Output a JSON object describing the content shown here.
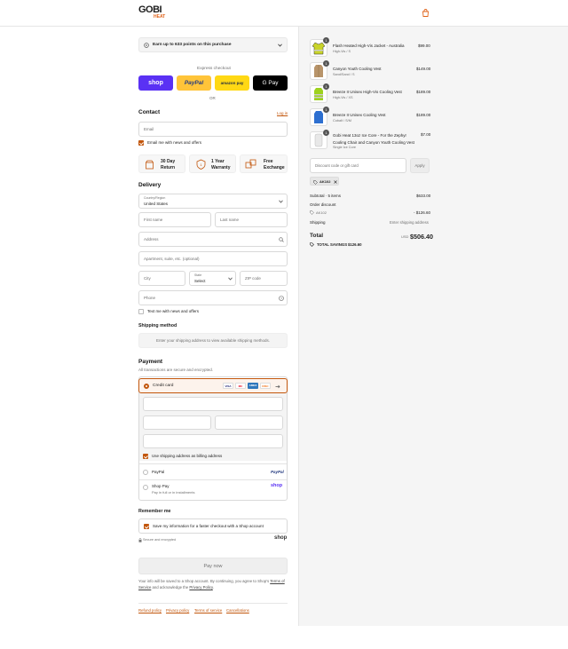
{
  "header": {
    "logo_main": "GOBI",
    "logo_sub": "HEAT"
  },
  "points": {
    "text": "Earn up to 633 points on this purchase"
  },
  "express": {
    "title": "Express checkout",
    "or": "OR",
    "shop": "shop",
    "paypal": "PayPal",
    "amazon": "amazon pay",
    "gpay": "G Pay"
  },
  "contact": {
    "title": "Contact",
    "login": "Log in",
    "email_placeholder": "Email",
    "news_label": "Email me with news and offers"
  },
  "perks": [
    {
      "title": "30 Day",
      "sub": "Return"
    },
    {
      "title": "1 Year",
      "sub": "Warranty"
    },
    {
      "title": "Free",
      "sub": "Exchange"
    }
  ],
  "delivery": {
    "title": "Delivery",
    "country_label": "Country/Region",
    "country_value": "United States",
    "first": "First name",
    "last": "Last name",
    "address": "Address",
    "apt": "Apartment, suite, etc. (optional)",
    "city": "City",
    "state_label": "State",
    "state_value": "Select",
    "zip": "ZIP code",
    "phone": "Phone",
    "text_me": "Text me with news and offers"
  },
  "shipping_method": {
    "title": "Shipping method",
    "placeholder": "Enter your shipping address to view available shipping methods."
  },
  "payment": {
    "title": "Payment",
    "subtitle": "All transactions are secure and encrypted.",
    "credit_card": "Credit card",
    "cards": [
      "VISA",
      "MC",
      "AMEX",
      "DISC"
    ],
    "billing_label": "Use shipping address as billing address",
    "paypal": "PayPal",
    "paypal_logo": "PayPal",
    "shop_pay": "Shop Pay",
    "shop_pay_sub": "Pay in full or in installments",
    "shop_logo": "shop"
  },
  "remember": {
    "title": "Remember me",
    "save_label": "Save my information for a faster checkout with a Shop account",
    "secure": "Secure and encrypted",
    "shop_logo": "shop"
  },
  "pay_now": "Pay now",
  "legal": {
    "pre": "Your info will be saved to a Shop account. By continuing, you agree to Shop's",
    "terms": "Terms of Service",
    "mid": "and acknowledge the",
    "privacy": "Privacy Policy",
    "end": "."
  },
  "footer_links": [
    "Refund policy",
    "Privacy policy",
    "Terms of service",
    "Cancellations"
  ],
  "order": {
    "items": [
      {
        "name": "Flash Heated High-Vis Jacket - Australia",
        "variant": "High-Vis / S",
        "price": "$99.00",
        "qty": "1",
        "color": "#c9d42a"
      },
      {
        "name": "Canyon Youth Cooling Vest",
        "variant": "Sand/Sand / S",
        "price": "$149.00",
        "qty": "1",
        "color": "#b8946a"
      },
      {
        "name": "Breeze II Unisex High-Vis Cooling Vest",
        "variant": "High-Vis / XS",
        "price": "$189.00",
        "qty": "1",
        "color": "#9ed21e"
      },
      {
        "name": "Breeze II Unisex Cooling Vest",
        "variant": "Cobalt / S/M",
        "price": "$189.00",
        "qty": "1",
        "color": "#2d6fd0"
      },
      {
        "name": "Gobi Heat 13oz Ice Core - For the Zephyr Cooling Chair and Canyon Youth Cooling Vest",
        "variant": "Single Ice Core",
        "price": "$7.00",
        "qty": "1",
        "color": "#d9d9d9"
      }
    ],
    "discount_placeholder": "Discount code or gift card",
    "apply": "Apply",
    "code": "AK102",
    "subtotal_label": "Subtotal · 5 items",
    "subtotal": "$633.00",
    "order_discount": "Order discount",
    "discount_code": "AK102",
    "discount_value": "- $126.60",
    "shipping_label": "Shipping",
    "shipping_value": "Enter shipping address",
    "total_label": "Total",
    "currency": "USD",
    "total": "$506.40",
    "savings_label": "TOTAL SAVINGS",
    "savings": "$126.60"
  },
  "colors": {
    "accent": "#c2560c",
    "shop": "#5a31f4",
    "paypal": "#ffc439",
    "amazon": "#ffd814",
    "gpay": "#000000"
  }
}
